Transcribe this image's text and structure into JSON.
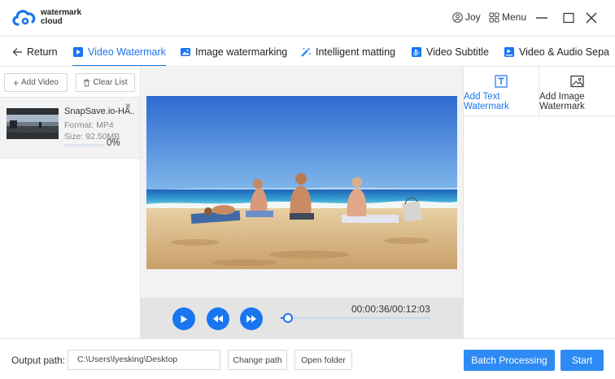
{
  "app": {
    "name_line1": "watermark",
    "name_line2": "cloud",
    "user_name": "Joy",
    "menu_label": "Menu"
  },
  "tabs": [
    {
      "label": "Return",
      "icon": "arrow-left-icon"
    },
    {
      "label": "Video Watermark",
      "icon": "video-icon",
      "active": true
    },
    {
      "label": "Image watermarking",
      "icon": "image-icon"
    },
    {
      "label": "Intelligent matting",
      "icon": "magic-wand-icon"
    },
    {
      "label": "Video Subtitle",
      "icon": "subtitle-icon"
    },
    {
      "label": "Video & Audio Sepa",
      "icon": "audio-video-icon"
    }
  ],
  "file_panel": {
    "add_video_label": "Add Video",
    "clear_list_label": "Clear List",
    "file": {
      "name": "SnapSave.io-HA...",
      "format": "Format:  MP4",
      "size": "Size:  92.50MB",
      "progress": 0,
      "progress_label": "0%"
    }
  },
  "player": {
    "time": "00:00:36/00:12:03",
    "seek_fraction": 0.05
  },
  "watermark_panel": {
    "add_text_label": "Add Text Watermark",
    "add_image_label": "Add Image Watermark"
  },
  "footer": {
    "output_label": "Output path:",
    "output_path": "C:\\Users\\lyesking\\Desktop",
    "change_path_label": "Change path",
    "open_folder_label": "Open folder",
    "batch_label": "Batch Processing",
    "start_label": "Start"
  },
  "colors": {
    "accent": "#1976f0",
    "primary_button": "#2e8bf5",
    "control_bar": "#e4e4e4"
  }
}
